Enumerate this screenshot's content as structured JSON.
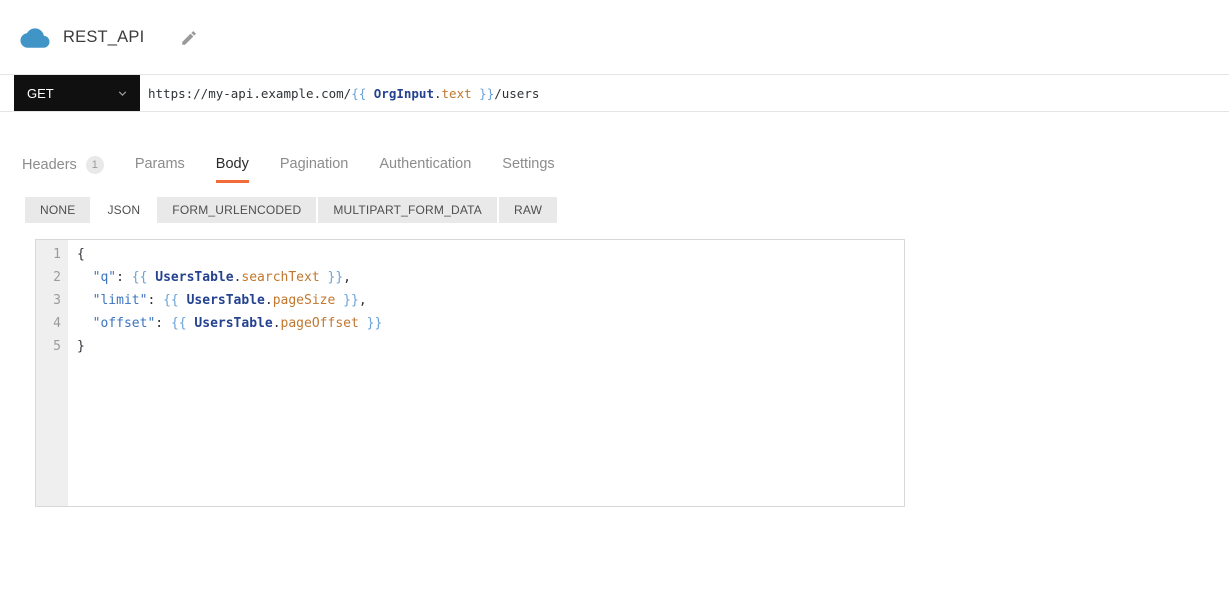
{
  "colors": {
    "accent": "#f26b3a",
    "method_bg": "#101010",
    "cloud": "#4195c6",
    "icon_gray": "#9a9a9a",
    "token_plain": "#2f3337",
    "token_brace": "#6aa2d8",
    "token_entity": "#24428f",
    "token_property": "#c2772e",
    "token_key": "#3a74c0",
    "gutter_bg": "#efefef",
    "subtab_bg": "#e9e9e9"
  },
  "header": {
    "title": "REST_API",
    "icons": [
      "cloud-icon",
      "pencil-icon"
    ]
  },
  "request": {
    "method": "GET",
    "url_segments": [
      {
        "text": "https://my-api.example.com/",
        "style": "plain"
      },
      {
        "text": "{{ ",
        "style": "brace"
      },
      {
        "text": "OrgInput",
        "style": "entity"
      },
      {
        "text": ".",
        "style": "plain"
      },
      {
        "text": "text",
        "style": "property"
      },
      {
        "text": " }}",
        "style": "brace"
      },
      {
        "text": "/users",
        "style": "plain"
      }
    ]
  },
  "tabs": [
    {
      "label": "Headers",
      "badge": "1",
      "active": false
    },
    {
      "label": "Params",
      "active": false
    },
    {
      "label": "Body",
      "active": true
    },
    {
      "label": "Pagination",
      "active": false
    },
    {
      "label": "Authentication",
      "active": false
    },
    {
      "label": "Settings",
      "active": false
    }
  ],
  "body_type_tabs": [
    {
      "label": "NONE",
      "active": false
    },
    {
      "label": "JSON",
      "active": true
    },
    {
      "label": "FORM_URLENCODED",
      "active": false
    },
    {
      "label": "MULTIPART_FORM_DATA",
      "active": false
    },
    {
      "label": "RAW",
      "active": false
    }
  ],
  "editor": {
    "lines": [
      {
        "num": "1",
        "segments": [
          {
            "text": "{",
            "style": "plain"
          }
        ]
      },
      {
        "num": "2",
        "segments": [
          {
            "text": "  ",
            "style": "plain"
          },
          {
            "text": "\"q\"",
            "style": "key"
          },
          {
            "text": ": ",
            "style": "plain"
          },
          {
            "text": "{{ ",
            "style": "brace"
          },
          {
            "text": "UsersTable",
            "style": "entity"
          },
          {
            "text": ".",
            "style": "plain"
          },
          {
            "text": "searchText",
            "style": "property"
          },
          {
            "text": " }}",
            "style": "brace"
          },
          {
            "text": ",",
            "style": "plain"
          }
        ]
      },
      {
        "num": "3",
        "segments": [
          {
            "text": "  ",
            "style": "plain"
          },
          {
            "text": "\"limit\"",
            "style": "key"
          },
          {
            "text": ": ",
            "style": "plain"
          },
          {
            "text": "{{ ",
            "style": "brace"
          },
          {
            "text": "UsersTable",
            "style": "entity"
          },
          {
            "text": ".",
            "style": "plain"
          },
          {
            "text": "pageSize",
            "style": "property"
          },
          {
            "text": " }}",
            "style": "brace"
          },
          {
            "text": ",",
            "style": "plain"
          }
        ]
      },
      {
        "num": "4",
        "segments": [
          {
            "text": "  ",
            "style": "plain"
          },
          {
            "text": "\"offset\"",
            "style": "key"
          },
          {
            "text": ": ",
            "style": "plain"
          },
          {
            "text": "{{ ",
            "style": "brace"
          },
          {
            "text": "UsersTable",
            "style": "entity"
          },
          {
            "text": ".",
            "style": "plain"
          },
          {
            "text": "pageOffset",
            "style": "property"
          },
          {
            "text": " }}",
            "style": "brace"
          }
        ]
      },
      {
        "num": "5",
        "segments": [
          {
            "text": "}",
            "style": "plain"
          }
        ]
      }
    ]
  }
}
